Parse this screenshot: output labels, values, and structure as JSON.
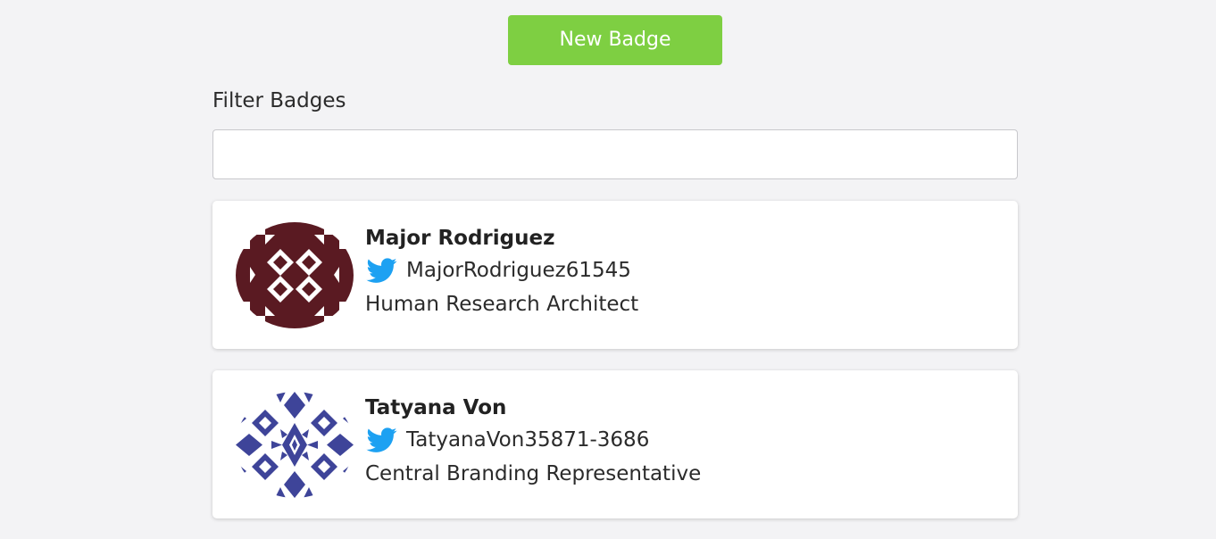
{
  "header": {
    "new_badge_label": "New Badge"
  },
  "filter": {
    "label": "Filter Badges",
    "value": "",
    "placeholder": ""
  },
  "badges": [
    {
      "name": "Major Rodriguez",
      "twitter": "MajorRodriguez61545",
      "job_title": "Human Research Architect",
      "avatar_color": "#5a1a22",
      "avatar_icon": "identicon-diamonds"
    },
    {
      "name": "Tatyana Von",
      "twitter": "TatyanaVon35871-3686",
      "job_title": "Central Branding Representative",
      "avatar_color": "#3e4499",
      "avatar_icon": "identicon-star-pattern"
    }
  ],
  "colors": {
    "accent_green": "#7ecf42",
    "twitter_blue": "#1da1f2",
    "background": "#f3f3f5"
  }
}
